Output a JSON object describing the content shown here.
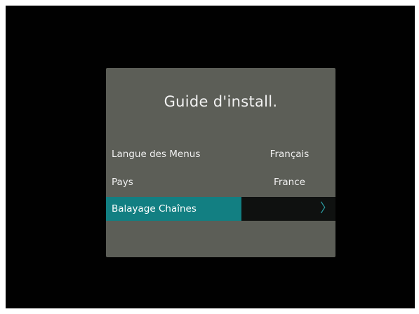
{
  "dialog": {
    "title": "Guide d'install.",
    "rows": [
      {
        "label": "Langue des Menus",
        "value": "Français"
      },
      {
        "label": "Pays",
        "value": "France"
      },
      {
        "label": "Balayage Chaînes",
        "value": ""
      }
    ],
    "selected_index": 2,
    "arrow_icon": "chevron-right-icon"
  },
  "colors": {
    "dialog_bg": "#5c5e57",
    "highlight": "#127f82",
    "value_highlight_bg": "#0f1110",
    "screen_bg": "#010101"
  }
}
